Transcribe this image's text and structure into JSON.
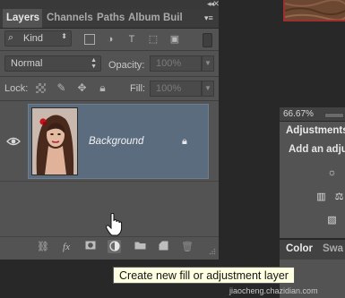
{
  "panel": {
    "tabs": [
      "Layers",
      "Channels",
      "Paths",
      "Album Buil"
    ],
    "menu_icon": "panel-menu-icon",
    "collapse_glyph": "◂◂",
    "close_glyph": "✕",
    "filter": {
      "kind_label": "Kind",
      "icons": [
        "pixel-filter-icon",
        "adjustment-filter-icon",
        "type-filter-icon",
        "shape-filter-icon",
        "smart-object-filter-icon"
      ]
    },
    "blend": {
      "mode": "Normal",
      "opacity_label": "Opacity:",
      "opacity_value": "100%"
    },
    "lock": {
      "label": "Lock:",
      "fill_label": "Fill:",
      "fill_value": "100%"
    },
    "layers": [
      {
        "name": "Background",
        "visible": true,
        "locked": true,
        "selected": true
      }
    ],
    "bottom_buttons": [
      "link-layers-icon",
      "fx-icon",
      "layer-mask-icon",
      "adjustment-layer-icon",
      "new-group-icon",
      "new-layer-icon",
      "delete-layer-icon"
    ],
    "fx_label": "fx"
  },
  "right_dock": {
    "zoom": "66.67%",
    "adjustments_tab": "Adjustments",
    "adjustments_subtitle": "Add an adju",
    "color_tab": "Color",
    "swatches_tab": "Swa"
  },
  "tooltip": "Create new fill or adjustment layer",
  "watermark": "jiaocheng.chazidian.com",
  "colors": {
    "panel_bg": "#535353",
    "selected_layer": "#5c6c7f",
    "tooltip_bg": "#ffffe1"
  }
}
